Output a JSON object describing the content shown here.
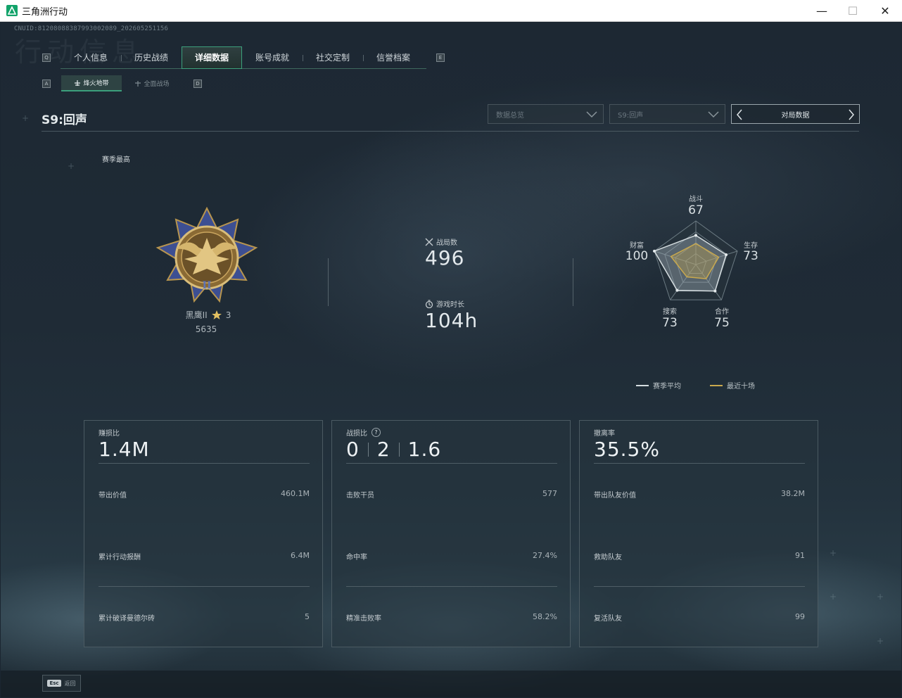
{
  "window": {
    "title": "三角洲行动",
    "minimize": "—",
    "maximize": "☐",
    "close": "✕"
  },
  "uid": "CNUID:81208088387993002089_202605251156",
  "background_text": "行动信息",
  "tabs": {
    "left_key": "Q",
    "right_key": "E",
    "items": [
      {
        "label": "个人信息"
      },
      {
        "label": "历史战绩"
      },
      {
        "label": "详细数据",
        "active": true
      },
      {
        "label": "账号成就"
      },
      {
        "label": "社交定制"
      },
      {
        "label": "信誉档案"
      }
    ]
  },
  "subtabs": {
    "left_key": "A",
    "right_key": "D",
    "items": [
      {
        "label": "烽火地带",
        "active": true
      },
      {
        "label": "全面战场"
      }
    ]
  },
  "season_title": "S9:回声",
  "filters": {
    "data_overview": "数据总览",
    "season": "S9:回声",
    "match_data": "对局数据"
  },
  "season_best_label": "赛季最高",
  "rank": {
    "name": "黑鹰II",
    "stars": "3",
    "score": "5635"
  },
  "stats": {
    "matches_label": "战局数",
    "matches_value": "496",
    "playtime_label": "游戏时长",
    "playtime_value": "104h"
  },
  "radar": {
    "combat_label": "战斗",
    "combat_value": "67",
    "survival_label": "生存",
    "survival_value": "73",
    "teamwork_label": "合作",
    "teamwork_value": "75",
    "search_label": "搜索",
    "search_value": "73",
    "wealth_label": "财富",
    "wealth_value": "100",
    "season_avg": [
      67,
      73,
      75,
      73,
      100
    ],
    "recent_ten": [
      48,
      55,
      40,
      35,
      60
    ]
  },
  "legend": {
    "season_avg": "赛季平均",
    "recent_ten": "最近十场",
    "season_avg_color": "#d5dde0",
    "recent_ten_color": "#c9a94e"
  },
  "cards": [
    {
      "title": "赚损比",
      "big": "1.4M",
      "rows": [
        {
          "label": "带出价值",
          "value": "460.1M"
        },
        {
          "label": "累计行动报酬",
          "value": "6.4M"
        },
        {
          "label": "累计破译曼德尔砖",
          "value": "5"
        }
      ]
    },
    {
      "title": "战损比",
      "help": "?",
      "kills": "0",
      "deaths": "2",
      "ratio": "1.6",
      "rows": [
        {
          "label": "击败干员",
          "value": "577"
        },
        {
          "label": "命中率",
          "value": "27.4%"
        },
        {
          "label": "精准击败率",
          "value": "58.2%"
        }
      ]
    },
    {
      "title": "撤离率",
      "big": "35.5%",
      "rows": [
        {
          "label": "带出队友价值",
          "value": "38.2M"
        },
        {
          "label": "救助队友",
          "value": "91"
        },
        {
          "label": "复活队友",
          "value": "99"
        }
      ]
    }
  ],
  "footer": {
    "esc_key": "Esc",
    "back_label": "返回"
  }
}
